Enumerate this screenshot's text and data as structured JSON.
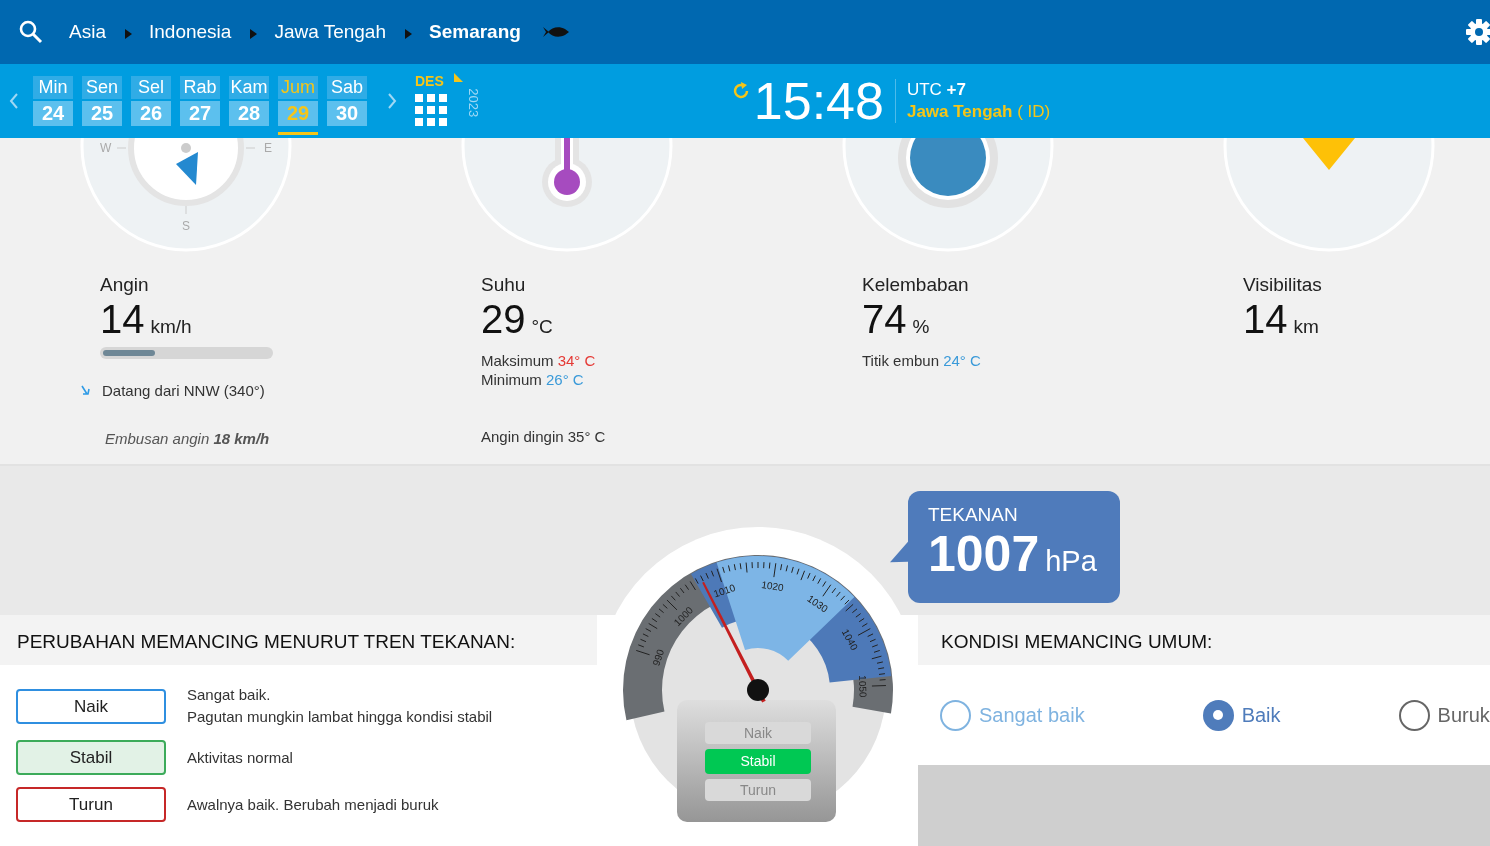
{
  "header": {
    "breadcrumbs": [
      {
        "label": "Asia",
        "current": false
      },
      {
        "label": "Indonesia",
        "current": false
      },
      {
        "label": "Jawa Tengah",
        "current": false
      },
      {
        "label": "Semarang",
        "current": true
      }
    ]
  },
  "date_bar": {
    "days": [
      {
        "name": "Min",
        "date": "24",
        "selected": false
      },
      {
        "name": "Sen",
        "date": "25",
        "selected": false
      },
      {
        "name": "Sel",
        "date": "26",
        "selected": false
      },
      {
        "name": "Rab",
        "date": "27",
        "selected": false
      },
      {
        "name": "Kam",
        "date": "28",
        "selected": false
      },
      {
        "name": "Jum",
        "date": "29",
        "selected": true
      },
      {
        "name": "Sab",
        "date": "30",
        "selected": false
      }
    ],
    "month": "DES",
    "year": "2023",
    "time": "15:48",
    "timezone": "UTC **+7**",
    "region": "**Jawa Tengah** ( ID)"
  },
  "weather": [
    {
      "kind": "wind",
      "title": "Angin",
      "value": "14",
      "unit": "km/h",
      "compass_labels": [
        "W",
        "E",
        "S"
      ],
      "level": 0.31,
      "direction": "Datang dari NNW (340°)",
      "gust": "Embusan angin **18 km/h**"
    },
    {
      "kind": "temperature",
      "title": "Suhu",
      "value": "29",
      "unit": "°C",
      "readings": [
        {
          "label": "Maksimum",
          "value": "34° C",
          "color": "#e53935"
        },
        {
          "label": "Minimum",
          "value": "26° C",
          "color": "#3a9ad9"
        }
      ],
      "note": "Angin dingin 35° C"
    },
    {
      "kind": "humidity",
      "title": "Kelembaban",
      "value": "74",
      "unit": "%",
      "readings": [
        {
          "label": "Titik embun",
          "value": "24° C",
          "color": "#3a9ad9"
        }
      ]
    },
    {
      "kind": "visibility",
      "title": "Visibilitas",
      "value": "14",
      "unit": "km"
    }
  ],
  "pressure": {
    "title": "TEKANAN",
    "value": "1007",
    "unit": "hPa",
    "gauge": {
      "scale": [
        "990",
        "1000",
        "1010",
        "1020",
        "1030",
        "1040",
        "1050"
      ],
      "trends": [
        {
          "label": "Naik",
          "selected": false
        },
        {
          "label": "Stabil",
          "selected": true
        },
        {
          "label": "Turun",
          "selected": false
        }
      ]
    }
  },
  "trend_guide": {
    "title": "PERUBAHAN MEMANCING MENURUT TREN TEKANAN:",
    "items": [
      {
        "label": "Naik",
        "color": "#2f8fe0",
        "selected": false,
        "lines": [
          "Sangat baik.",
          "Pagutan mungkin lambat hingga kondisi stabil"
        ]
      },
      {
        "label": "Stabil",
        "color": "#3cab5a",
        "selected": true,
        "lines": [
          "Aktivitas normal"
        ]
      },
      {
        "label": "Turun",
        "color": "#c62828",
        "selected": false,
        "lines": [
          "Awalnya baik. Berubah menjadi buruk"
        ]
      }
    ]
  },
  "conditions": {
    "title": "KONDISI MEMANCING UMUM:",
    "options": [
      {
        "label": "Sangat baik",
        "color": "#7fb3e0",
        "selected": false
      },
      {
        "label": "Baik",
        "color": "#4f7cbb",
        "selected": true
      },
      {
        "label": "Buruk",
        "color": "#666666",
        "selected": false
      }
    ]
  }
}
